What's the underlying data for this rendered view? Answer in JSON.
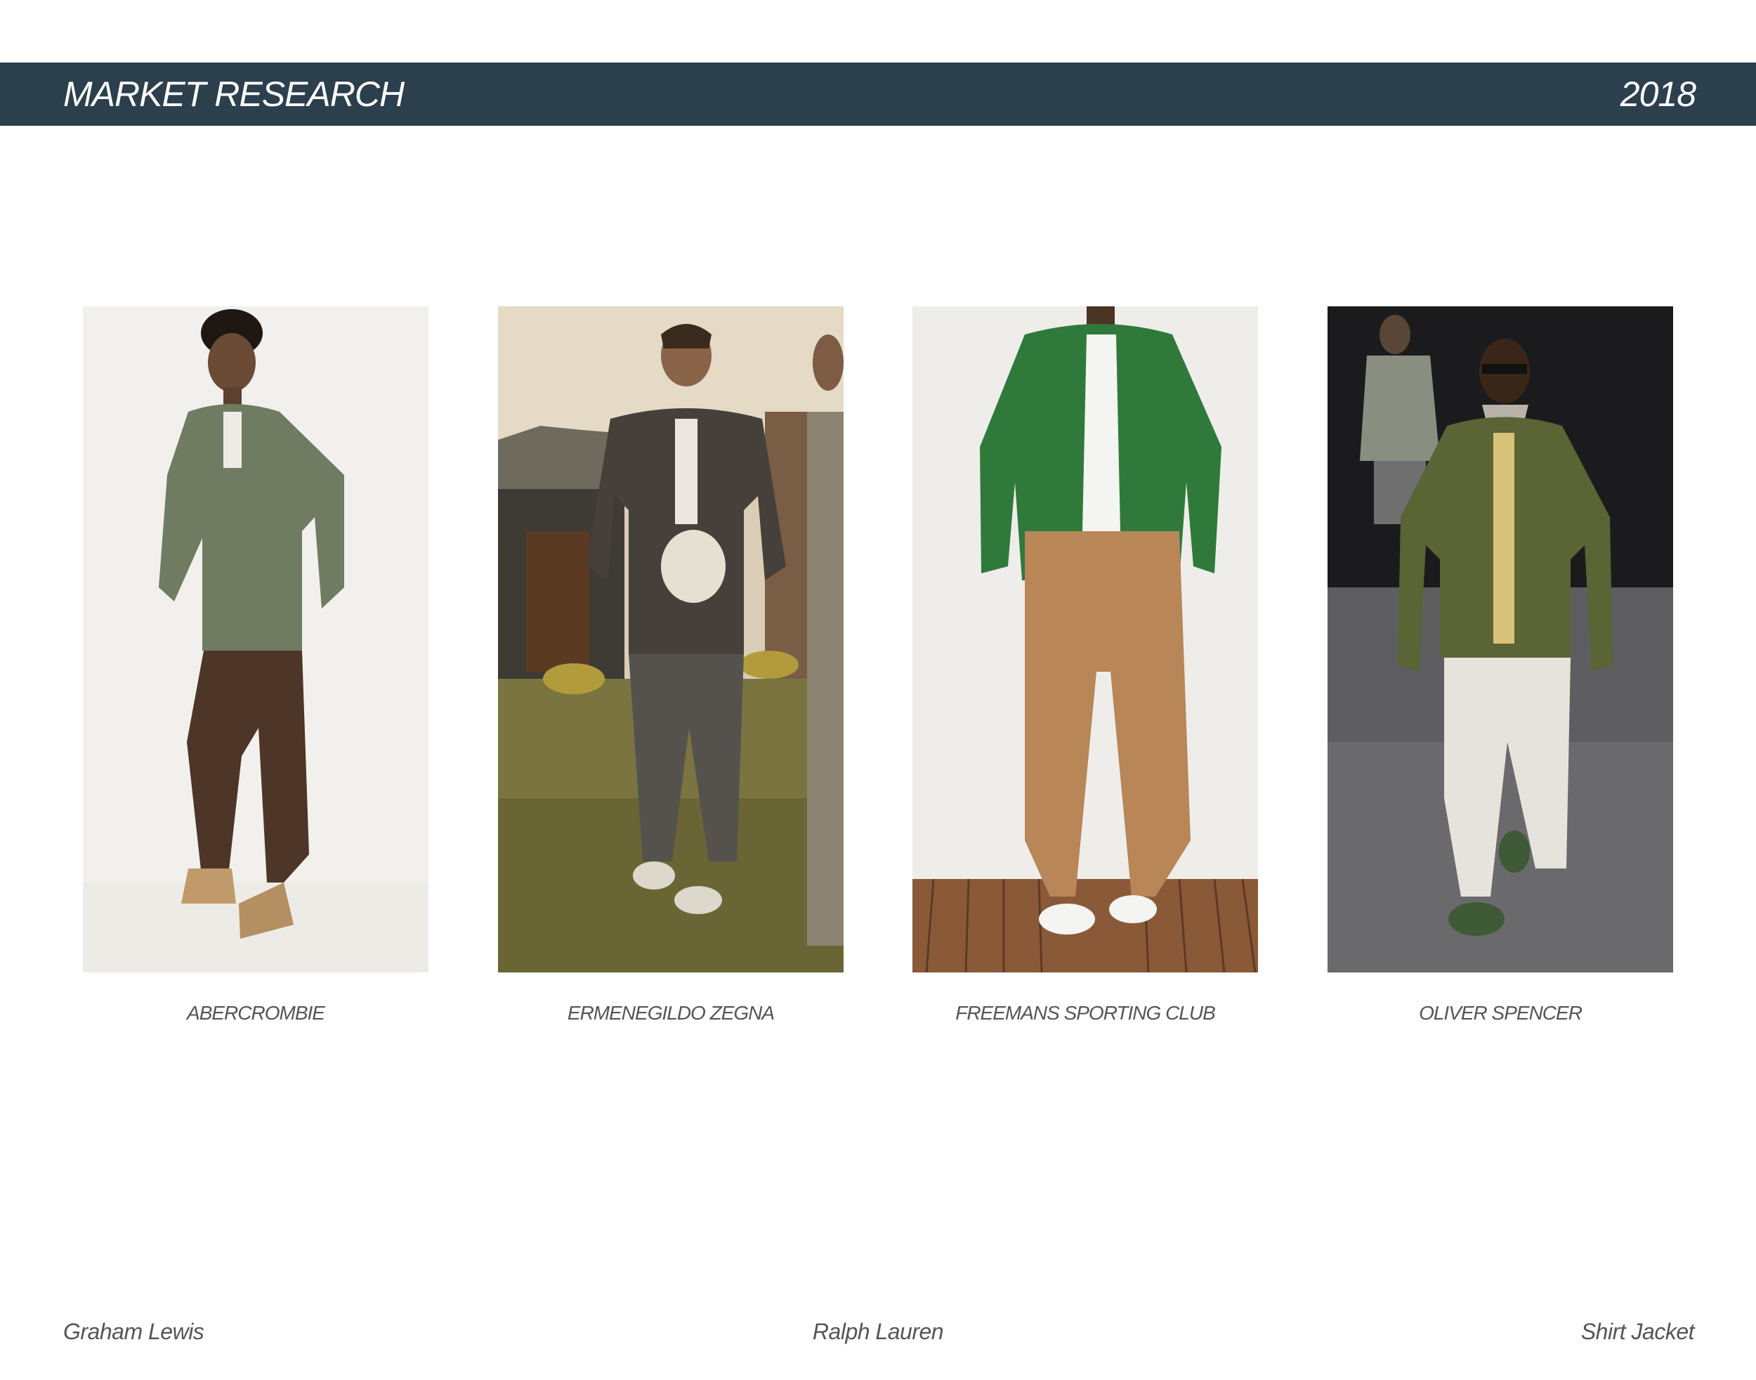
{
  "header": {
    "title": "MARKET RESEARCH",
    "year": "2018",
    "background": "#2b3f4d"
  },
  "cards": [
    {
      "caption": "ABERCROMBIE"
    },
    {
      "caption": "ERMENEGILDO ZEGNA"
    },
    {
      "caption": "FREEMANS SPORTING CLUB"
    },
    {
      "caption": "OLIVER SPENCER"
    }
  ],
  "footer": {
    "left": "Graham Lewis",
    "center": "Ralph Lauren",
    "right": "Shirt Jacket"
  }
}
